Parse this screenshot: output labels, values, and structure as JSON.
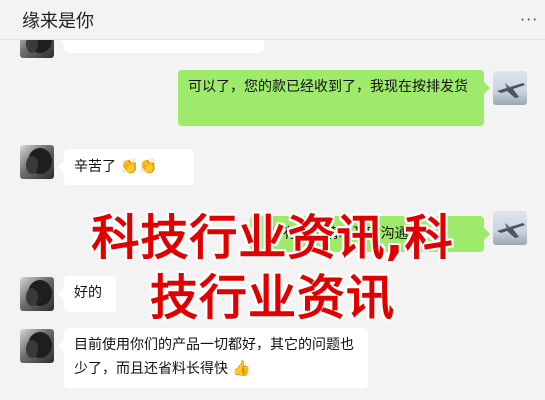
{
  "window": {
    "title": "缘来是你",
    "more_label": "···"
  },
  "messages": [
    {
      "id": "m0",
      "side": "in",
      "text": ""
    },
    {
      "id": "m1",
      "side": "out",
      "text": "可以了，您的款已经收到了，我现在按排发货"
    },
    {
      "id": "m2",
      "side": "in",
      "text": "辛苦了",
      "emoji": "👏👏"
    },
    {
      "id": "m3",
      "side": "out",
      "text": "有什么情况及时沟通",
      "emoji": "👏"
    },
    {
      "id": "m4",
      "side": "in",
      "text": "好的"
    },
    {
      "id": "m5",
      "side": "in",
      "text": "目前使用你们的产品一切都好，其它的问题也少了，而且还省料长得快",
      "emoji": "👍"
    }
  ],
  "overlay": {
    "line1": "科技行业资讯,科",
    "line2": "技行业资讯",
    "color": "#e00000"
  },
  "avatars": {
    "contact": "contact-avatar",
    "self": "self-avatar-jet"
  }
}
